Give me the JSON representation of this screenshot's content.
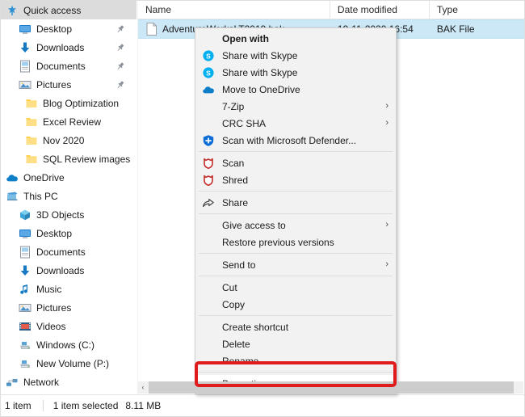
{
  "app": {
    "name": "File Explorer"
  },
  "nav": {
    "items": [
      {
        "label": "Quick access",
        "icon": "star-pin-icon",
        "indent": 0,
        "selected": true,
        "pinned": false
      },
      {
        "label": "Desktop",
        "icon": "desktop-icon",
        "indent": 1,
        "selected": false,
        "pinned": true
      },
      {
        "label": "Downloads",
        "icon": "download-icon",
        "indent": 1,
        "selected": false,
        "pinned": true
      },
      {
        "label": "Documents",
        "icon": "documents-icon",
        "indent": 1,
        "selected": false,
        "pinned": true
      },
      {
        "label": "Pictures",
        "icon": "pictures-icon",
        "indent": 1,
        "selected": false,
        "pinned": true
      },
      {
        "label": "Blog Optimization",
        "icon": "folder-icon",
        "indent": 2,
        "selected": false,
        "pinned": false
      },
      {
        "label": "Excel Review",
        "icon": "folder-icon",
        "indent": 2,
        "selected": false,
        "pinned": false
      },
      {
        "label": "Nov 2020",
        "icon": "folder-icon",
        "indent": 2,
        "selected": false,
        "pinned": false
      },
      {
        "label": "SQL Review images",
        "icon": "folder-icon",
        "indent": 2,
        "selected": false,
        "pinned": false
      },
      {
        "label": "OneDrive",
        "icon": "onedrive-icon",
        "indent": 0,
        "selected": false,
        "pinned": false
      },
      {
        "label": "This PC",
        "icon": "thispc-icon",
        "indent": 0,
        "selected": false,
        "pinned": false
      },
      {
        "label": "3D Objects",
        "icon": "3dobjects-icon",
        "indent": 1,
        "selected": false,
        "pinned": false
      },
      {
        "label": "Desktop",
        "icon": "desktop-icon",
        "indent": 1,
        "selected": false,
        "pinned": false
      },
      {
        "label": "Documents",
        "icon": "documents-icon",
        "indent": 1,
        "selected": false,
        "pinned": false
      },
      {
        "label": "Downloads",
        "icon": "download-icon",
        "indent": 1,
        "selected": false,
        "pinned": false
      },
      {
        "label": "Music",
        "icon": "music-icon",
        "indent": 1,
        "selected": false,
        "pinned": false
      },
      {
        "label": "Pictures",
        "icon": "pictures-icon",
        "indent": 1,
        "selected": false,
        "pinned": false
      },
      {
        "label": "Videos",
        "icon": "videos-icon",
        "indent": 1,
        "selected": false,
        "pinned": false
      },
      {
        "label": "Windows (C:)",
        "icon": "drive-icon",
        "indent": 1,
        "selected": false,
        "pinned": false
      },
      {
        "label": "New Volume (P:)",
        "icon": "drive-icon",
        "indent": 1,
        "selected": false,
        "pinned": false
      },
      {
        "label": "Network",
        "icon": "network-icon",
        "indent": 0,
        "selected": false,
        "pinned": false
      }
    ]
  },
  "file_list": {
    "columns": [
      "Name",
      "Date modified",
      "Type"
    ],
    "rows": [
      {
        "name": "AdventureWorksLT2019.bak",
        "date_modified": "19-11-2020 16:54",
        "type": "BAK File",
        "icon": "file-icon",
        "selected": true
      }
    ]
  },
  "context_menu": {
    "items": [
      {
        "label": "Open with",
        "icon": "",
        "bold": true,
        "submenu": false,
        "sep_after": false
      },
      {
        "label": "Share with Skype",
        "icon": "skype-icon",
        "bold": false,
        "submenu": false,
        "sep_after": false
      },
      {
        "label": "Share with Skype",
        "icon": "skype-icon",
        "bold": false,
        "submenu": false,
        "sep_after": false
      },
      {
        "label": "Move to OneDrive",
        "icon": "onedrive-icon",
        "bold": false,
        "submenu": false,
        "sep_after": false
      },
      {
        "label": "7-Zip",
        "icon": "",
        "bold": false,
        "submenu": true,
        "sep_after": false
      },
      {
        "label": "CRC SHA",
        "icon": "",
        "bold": false,
        "submenu": true,
        "sep_after": false
      },
      {
        "label": "Scan with Microsoft Defender...",
        "icon": "defender-icon",
        "bold": false,
        "submenu": false,
        "sep_after": true
      },
      {
        "label": "Scan",
        "icon": "shield-red-icon",
        "bold": false,
        "submenu": false,
        "sep_after": false
      },
      {
        "label": "Shred",
        "icon": "shield-red-icon",
        "bold": false,
        "submenu": false,
        "sep_after": true
      },
      {
        "label": "Share",
        "icon": "share-icon",
        "bold": false,
        "submenu": false,
        "sep_after": true
      },
      {
        "label": "Give access to",
        "icon": "",
        "bold": false,
        "submenu": true,
        "sep_after": false
      },
      {
        "label": "Restore previous versions",
        "icon": "",
        "bold": false,
        "submenu": false,
        "sep_after": true
      },
      {
        "label": "Send to",
        "icon": "",
        "bold": false,
        "submenu": true,
        "sep_after": true
      },
      {
        "label": "Cut",
        "icon": "",
        "bold": false,
        "submenu": false,
        "sep_after": false
      },
      {
        "label": "Copy",
        "icon": "",
        "bold": false,
        "submenu": false,
        "sep_after": true
      },
      {
        "label": "Create shortcut",
        "icon": "",
        "bold": false,
        "submenu": false,
        "sep_after": false
      },
      {
        "label": "Delete",
        "icon": "",
        "bold": false,
        "submenu": false,
        "sep_after": false
      },
      {
        "label": "Rename",
        "icon": "",
        "bold": false,
        "submenu": false,
        "sep_after": true
      },
      {
        "label": "Properties",
        "icon": "",
        "bold": false,
        "submenu": false,
        "sep_after": false,
        "highlighted": true
      }
    ]
  },
  "scrollbar": {
    "left_arrow": "‹"
  },
  "status_bar": {
    "item_count": "1 item",
    "selection": "1 item selected",
    "size": "8.11 MB"
  },
  "colors": {
    "selection_blue": "#cce8f7",
    "menu_background": "#f2f2f2",
    "highlight_red": "#e01b1b",
    "skype_blue": "#00aff0",
    "onedrive_blue": "#0364b8",
    "defender_blue": "#0a6cd6",
    "shield_red": "#c42b2b",
    "folder_yellow": "#ffd14f"
  }
}
